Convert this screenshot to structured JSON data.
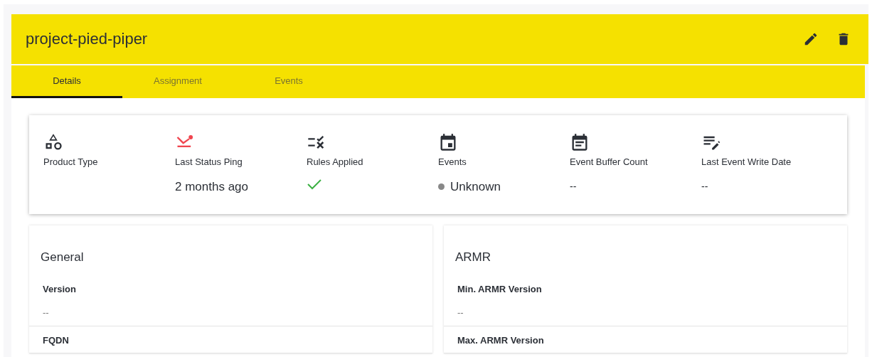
{
  "header": {
    "title": "project-pied-piper"
  },
  "tabs": [
    {
      "label": "Details",
      "selected": true
    },
    {
      "label": "Assignment",
      "selected": false
    },
    {
      "label": "Events",
      "selected": false
    }
  ],
  "stats": [
    {
      "kind": "empty",
      "label": "Product Type"
    },
    {
      "kind": "text",
      "label": "Last Status Ping",
      "value": "2 months ago"
    },
    {
      "kind": "check",
      "label": "Rules Applied",
      "checked": true
    },
    {
      "kind": "status",
      "label": "Events",
      "value": "Unknown",
      "color": "#888888"
    },
    {
      "kind": "muted",
      "label": "Event Buffer Count",
      "value": "--"
    },
    {
      "kind": "muted",
      "label": "Last Event Write Date",
      "value": "--"
    }
  ],
  "sections": [
    {
      "title": "General",
      "fields": [
        {
          "label": "Version",
          "value": "--"
        },
        {
          "label": "FQDN"
        }
      ]
    },
    {
      "title": "ARMR",
      "fields": [
        {
          "label": "Min. ARMR Version",
          "value": "--"
        },
        {
          "label": "Max. ARMR Version"
        }
      ]
    }
  ]
}
